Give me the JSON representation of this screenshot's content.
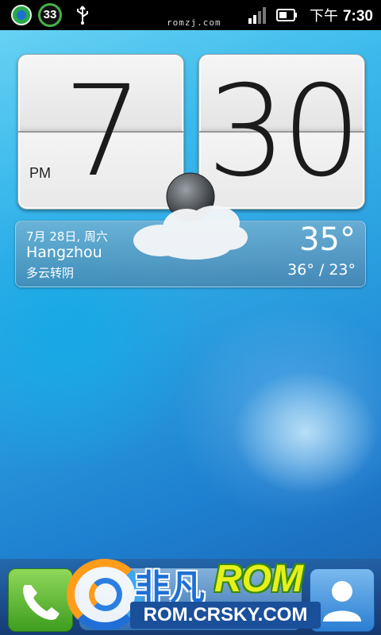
{
  "status_bar": {
    "battery_level": "33",
    "watermark": "romzj.com",
    "time_prefix": "下午",
    "time": "7:30",
    "icons": [
      "security-app-icon",
      "battery-badge",
      "usb-icon",
      "signal-icon",
      "sim-icon"
    ]
  },
  "clock_widget": {
    "hour": "7",
    "minute": "30",
    "ampm": "PM"
  },
  "weather_widget": {
    "date": "7月 28日, 周六",
    "city": "Hangzhou",
    "condition": "多云转阴",
    "temperature": "35°",
    "range": "36° / 23°",
    "icon": "cloudy-night-icon"
  },
  "dock": {
    "items": [
      "phone-icon",
      "app-launcher",
      "contacts-icon"
    ]
  },
  "logo_overlay": {
    "text": "非凡",
    "rom": "ROM",
    "url": "ROM.CRSKY.COM"
  },
  "colors": {
    "status_bar_bg": "#000000",
    "wallpaper_top": "#6fd6f4",
    "wallpaper_bottom": "#1a5fae"
  }
}
